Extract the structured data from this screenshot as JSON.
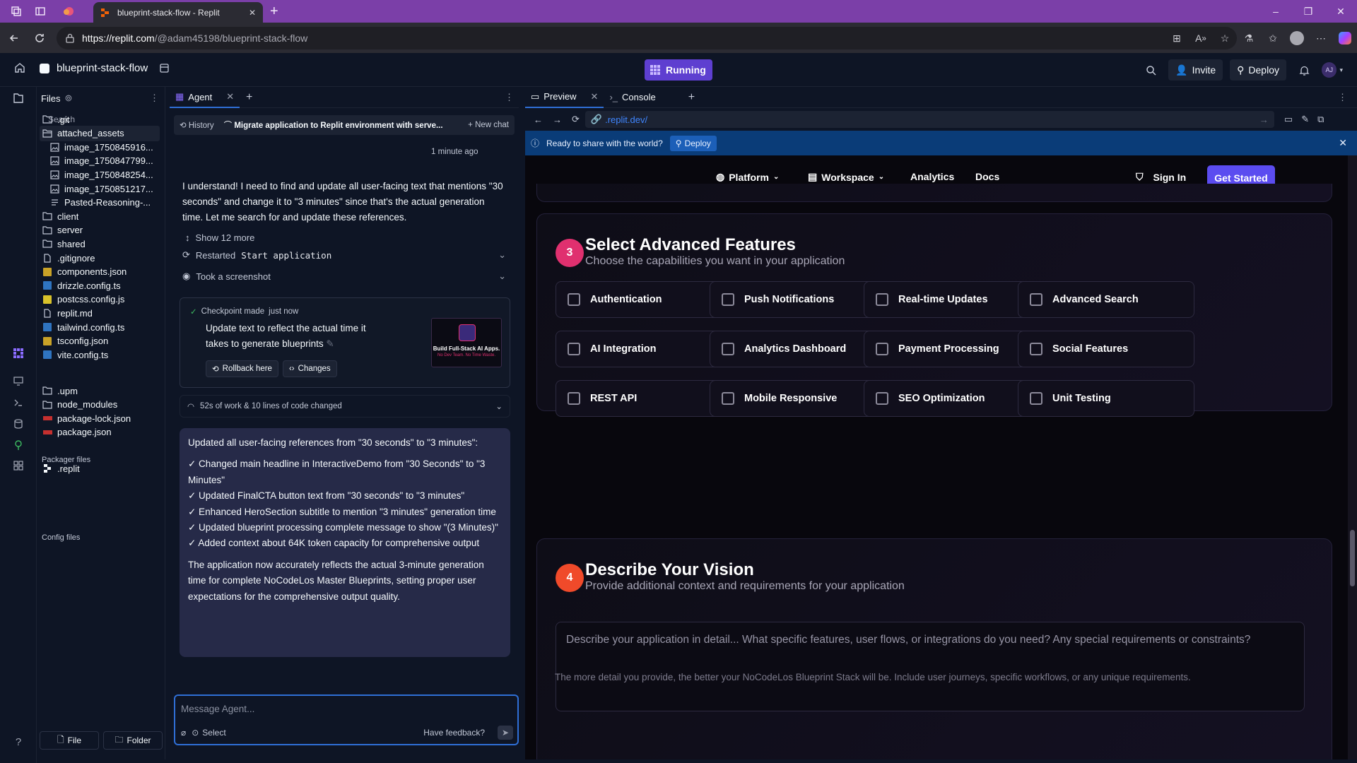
{
  "browser": {
    "tab_title": "blueprint-stack-flow - Replit",
    "url_host": "https://replit.com",
    "url_path": "/@adam45198/blueprint-stack-flow",
    "window_controls": [
      "–",
      "❐",
      "✕"
    ]
  },
  "topbar": {
    "project_name": "blueprint-stack-flow",
    "status": "Running",
    "invite_label": "Invite",
    "deploy_label": "Deploy",
    "avatar_initials": "AJ"
  },
  "files": {
    "title": "Files",
    "search_placeholder": "Search",
    "items": [
      {
        "name": ".git",
        "type": "folder"
      },
      {
        "name": "attached_assets",
        "type": "folder-open"
      },
      {
        "name": "image_1750845916...",
        "type": "image",
        "child": true
      },
      {
        "name": "image_1750847799...",
        "type": "image",
        "child": true
      },
      {
        "name": "image_1750848254...",
        "type": "image",
        "child": true
      },
      {
        "name": "image_1750851217...",
        "type": "image",
        "child": true
      },
      {
        "name": "Pasted-Reasoning-...",
        "type": "text",
        "child": true
      },
      {
        "name": "client",
        "type": "folder"
      },
      {
        "name": "server",
        "type": "folder"
      },
      {
        "name": "shared",
        "type": "folder"
      },
      {
        "name": ".gitignore",
        "type": "file"
      },
      {
        "name": "components.json",
        "type": "json"
      },
      {
        "name": "drizzle.config.ts",
        "type": "ts"
      },
      {
        "name": "postcss.config.js",
        "type": "js"
      },
      {
        "name": "replit.md",
        "type": "file"
      },
      {
        "name": "tailwind.config.ts",
        "type": "ts"
      },
      {
        "name": "tsconfig.json",
        "type": "json"
      },
      {
        "name": "vite.config.ts",
        "type": "ts"
      }
    ],
    "packager_title": "Packager files",
    "packager_items": [
      {
        "name": ".upm",
        "type": "folder"
      },
      {
        "name": "node_modules",
        "type": "folder"
      },
      {
        "name": "package-lock.json",
        "type": "npm"
      },
      {
        "name": "package.json",
        "type": "npm"
      }
    ],
    "config_title": "Config files",
    "config_items": [
      {
        "name": ".replit",
        "type": "replit"
      }
    ],
    "file_button": "File",
    "folder_button": "Folder"
  },
  "agent": {
    "tab_label": "Agent",
    "history_label": "History",
    "thread_title": "Migrate application to Replit environment with serve...",
    "new_chat_label": "New chat",
    "timestamp": "1 minute ago",
    "message": "I understand! I need to find and update all user-facing text that mentions \"30 seconds\" and change it to \"3 minutes\" since that's the actual generation time. Let me search for and update these references.",
    "show_more": "Show 12 more",
    "restarted_prefix": "Restarted",
    "restarted_cmd": "Start application",
    "screenshot_label": "Took a screenshot",
    "checkpoint_label": "Checkpoint made",
    "checkpoint_time": "just now",
    "checkpoint_text": "Update text to reflect the actual time it takes to generate blueprints",
    "rollback_label": "Rollback here",
    "changes_label": "Changes",
    "thumb_text": "Build Full-Stack AI Apps.",
    "thumb_sub": "No Dev Team. No Time Waste.",
    "work_summary": "52s of work & 10 lines of code changed",
    "summary_intro": "Updated all user-facing references from \"30 seconds\" to \"3 minutes\":",
    "summary_items": [
      "✓ Changed main headline in InteractiveDemo from \"30 Seconds\" to \"3 Minutes\"",
      "✓ Updated FinalCTA button text from \"30 seconds\" to \"3 minutes\"",
      "✓ Enhanced HeroSection subtitle to mention \"3 minutes\" generation time",
      "✓ Updated blueprint processing complete message to show \"(3 Minutes)\"",
      "✓ Added context about 64K token capacity for comprehensive output"
    ],
    "summary_outro": "The application now accurately reflects the actual 3-minute generation time for complete NoCodeLos Master Blueprints, setting proper user expectations for the comprehensive output quality.",
    "input_placeholder": "Message Agent...",
    "select_label": "Select",
    "feedback_label": "Have feedback?"
  },
  "preview": {
    "tab_preview": "Preview",
    "tab_console": "Console",
    "url": ".replit.dev/",
    "banner_text": "Ready to share with the world?",
    "banner_deploy": "Deploy",
    "site": {
      "nav_platform": "Platform",
      "nav_workspace": "Workspace",
      "nav_analytics": "Analytics",
      "nav_docs": "Docs",
      "sign_in": "Sign In",
      "get_started": "Get Started",
      "step3_num": "3",
      "step3_title": "Select Advanced Features",
      "step3_sub": "Choose the capabilities you want in your application",
      "features": [
        "Authentication",
        "Push Notifications",
        "Real-time Updates",
        "Advanced Search",
        "AI Integration",
        "Analytics Dashboard",
        "Payment Processing",
        "Social Features",
        "REST API",
        "Mobile Responsive",
        "SEO Optimization",
        "Unit Testing"
      ],
      "step4_num": "4",
      "step4_title": "Describe Your Vision",
      "step4_sub": "Provide additional context and requirements for your application",
      "vision_placeholder": "Describe your application in detail... What specific features, user flows, or integrations do you need? Any special requirements or constraints?",
      "vision_hint": "The more detail you provide, the better your NoCodeLos Blueprint Stack will be. Include user journeys, specific workflows, or any unique requirements."
    }
  },
  "colors": {
    "browser_frame": "#7b3fa8",
    "running": "#5e3fd0",
    "banner": "#0a3c78",
    "get_started": "#5b4cf0",
    "step3": "#e0306f",
    "step4": "#f04a2a"
  }
}
